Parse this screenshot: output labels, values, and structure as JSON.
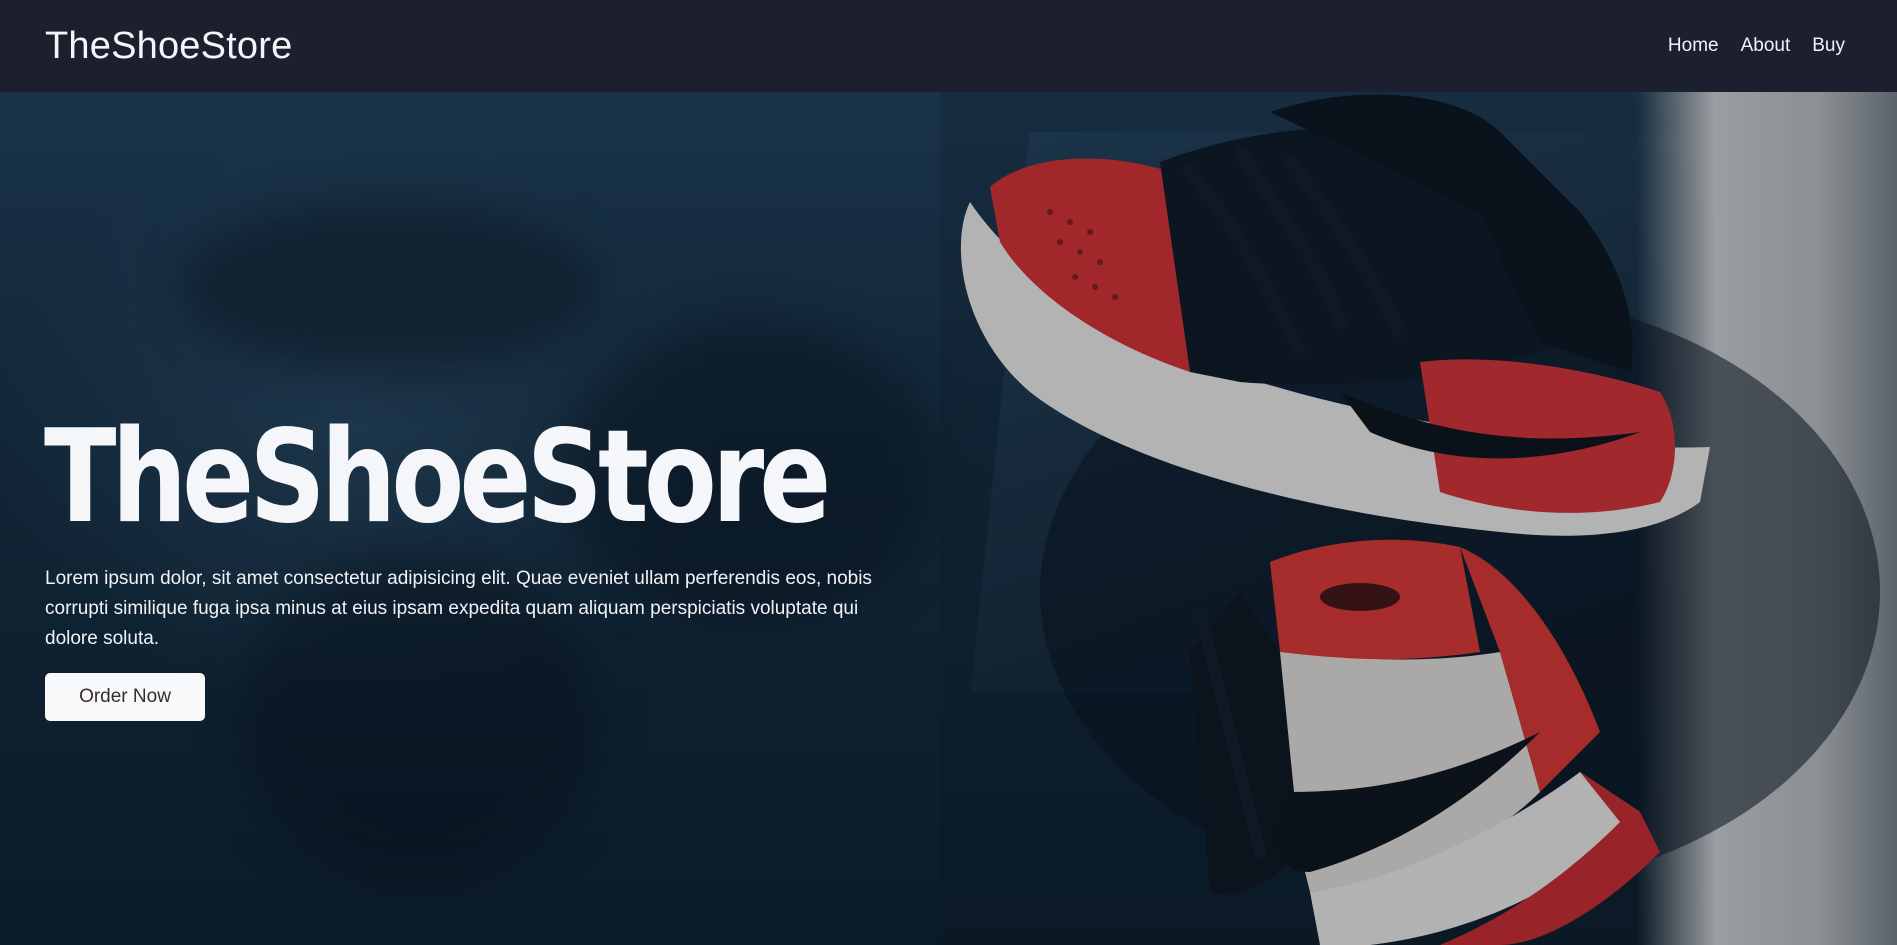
{
  "navbar": {
    "brand": "TheShoeStore",
    "links": [
      "Home",
      "About",
      "Buy"
    ]
  },
  "hero": {
    "title": "TheShoeStore",
    "description": "Lorem ipsum dolor, sit amet consectetur adipisicing elit. Quae eveniet ullam perferendis eos, nobis corrupti similique fuga ipsa minus at eius ipsam expedita quam aliquam perspiciatis voluptate qui dolore soluta.",
    "cta_label": "Order Now",
    "image_alt_name": "red-black-white-high-top-sneakers-photo"
  },
  "colors": {
    "navbar_bg": "#1c1f2d",
    "hero_bg": "#112536",
    "accent_red": "#c9302f",
    "text_light": "#f5f6fa",
    "button_bg": "#f8f9fa",
    "button_text": "#3a2b33"
  }
}
